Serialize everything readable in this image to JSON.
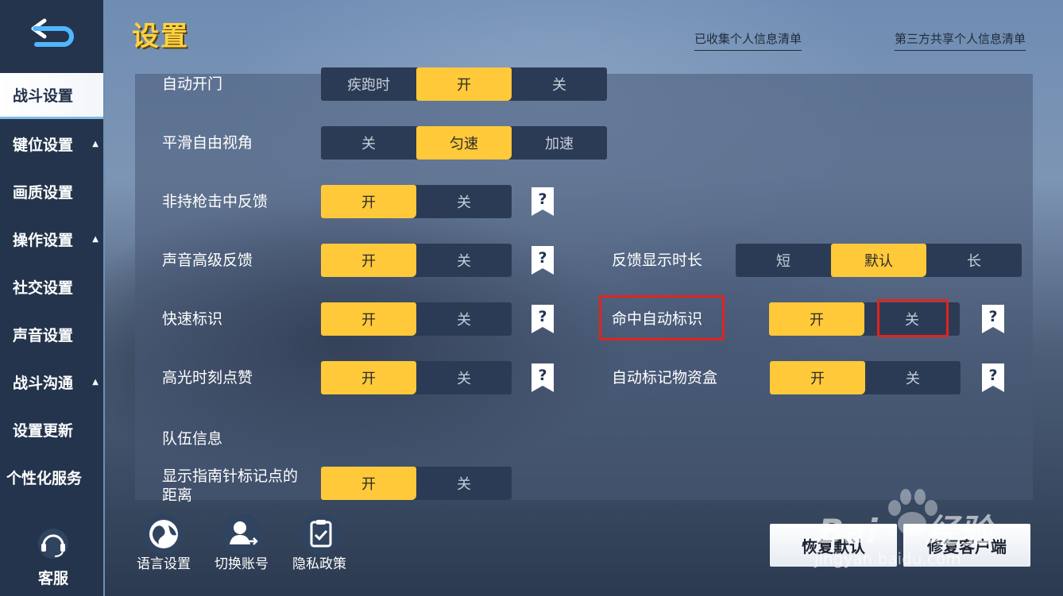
{
  "header": {
    "title": "设置",
    "links": [
      "已收集个人信息清单",
      "第三方共享个人信息清单"
    ]
  },
  "sidebar": {
    "items": [
      {
        "label": "战斗设置",
        "active": true,
        "expand": false
      },
      {
        "label": "键位设置",
        "active": false,
        "expand": true
      },
      {
        "label": "画质设置",
        "active": false,
        "expand": false
      },
      {
        "label": "操作设置",
        "active": false,
        "expand": true
      },
      {
        "label": "社交设置",
        "active": false,
        "expand": false
      },
      {
        "label": "声音设置",
        "active": false,
        "expand": false
      },
      {
        "label": "战斗沟通",
        "active": false,
        "expand": true
      },
      {
        "label": "设置更新",
        "active": false,
        "expand": false
      },
      {
        "label": "个性化服务",
        "active": false,
        "expand": false
      }
    ],
    "expand_glyph": "▲",
    "customer_service": "客服"
  },
  "settings": {
    "auto_door": {
      "label": "自动开门",
      "options": [
        "疾跑时",
        "开",
        "关"
      ],
      "selected": "开"
    },
    "smooth_view": {
      "label": "平滑自由视角",
      "options": [
        "关",
        "匀速",
        "加速"
      ],
      "selected": "匀速"
    },
    "unarmed_hit": {
      "label": "非持枪击中反馈",
      "options": [
        "开",
        "关"
      ],
      "selected": "开"
    },
    "sound_feedback": {
      "label": "声音高级反馈",
      "options": [
        "开",
        "关"
      ],
      "selected": "开"
    },
    "feedback_duration": {
      "label": "反馈显示时长",
      "options": [
        "短",
        "默认",
        "长"
      ],
      "selected": "默认"
    },
    "quick_mark": {
      "label": "快速标识",
      "options": [
        "开",
        "关"
      ],
      "selected": "开"
    },
    "hit_auto_mark": {
      "label": "命中自动标识",
      "options": [
        "开",
        "关"
      ],
      "selected": "开"
    },
    "highlight_like": {
      "label": "高光时刻点赞",
      "options": [
        "开",
        "关"
      ],
      "selected": "开"
    },
    "auto_mark_box": {
      "label": "自动标记物资盒",
      "options": [
        "开",
        "关"
      ],
      "selected": "开"
    },
    "team_info": {
      "label": "队伍信息"
    },
    "compass_distance": {
      "label_line1": "显示指南针标记点的",
      "label_line2": "距离",
      "options": [
        "开",
        "关"
      ],
      "selected": "开"
    }
  },
  "bottom": {
    "language": "语言设置",
    "switch_account": "切换账号",
    "privacy": "隐私政策",
    "restore_default": "恢复默认",
    "repair_client": "修复客户端"
  },
  "watermark": {
    "line1": "Bai",
    "line1b": "经验",
    "line2": "jingyan.baidu.com"
  },
  "colors": {
    "accent": "#ffc93a",
    "title": "#ffd23f",
    "highlight": "#e8211c",
    "sidebar": "#24344c"
  }
}
